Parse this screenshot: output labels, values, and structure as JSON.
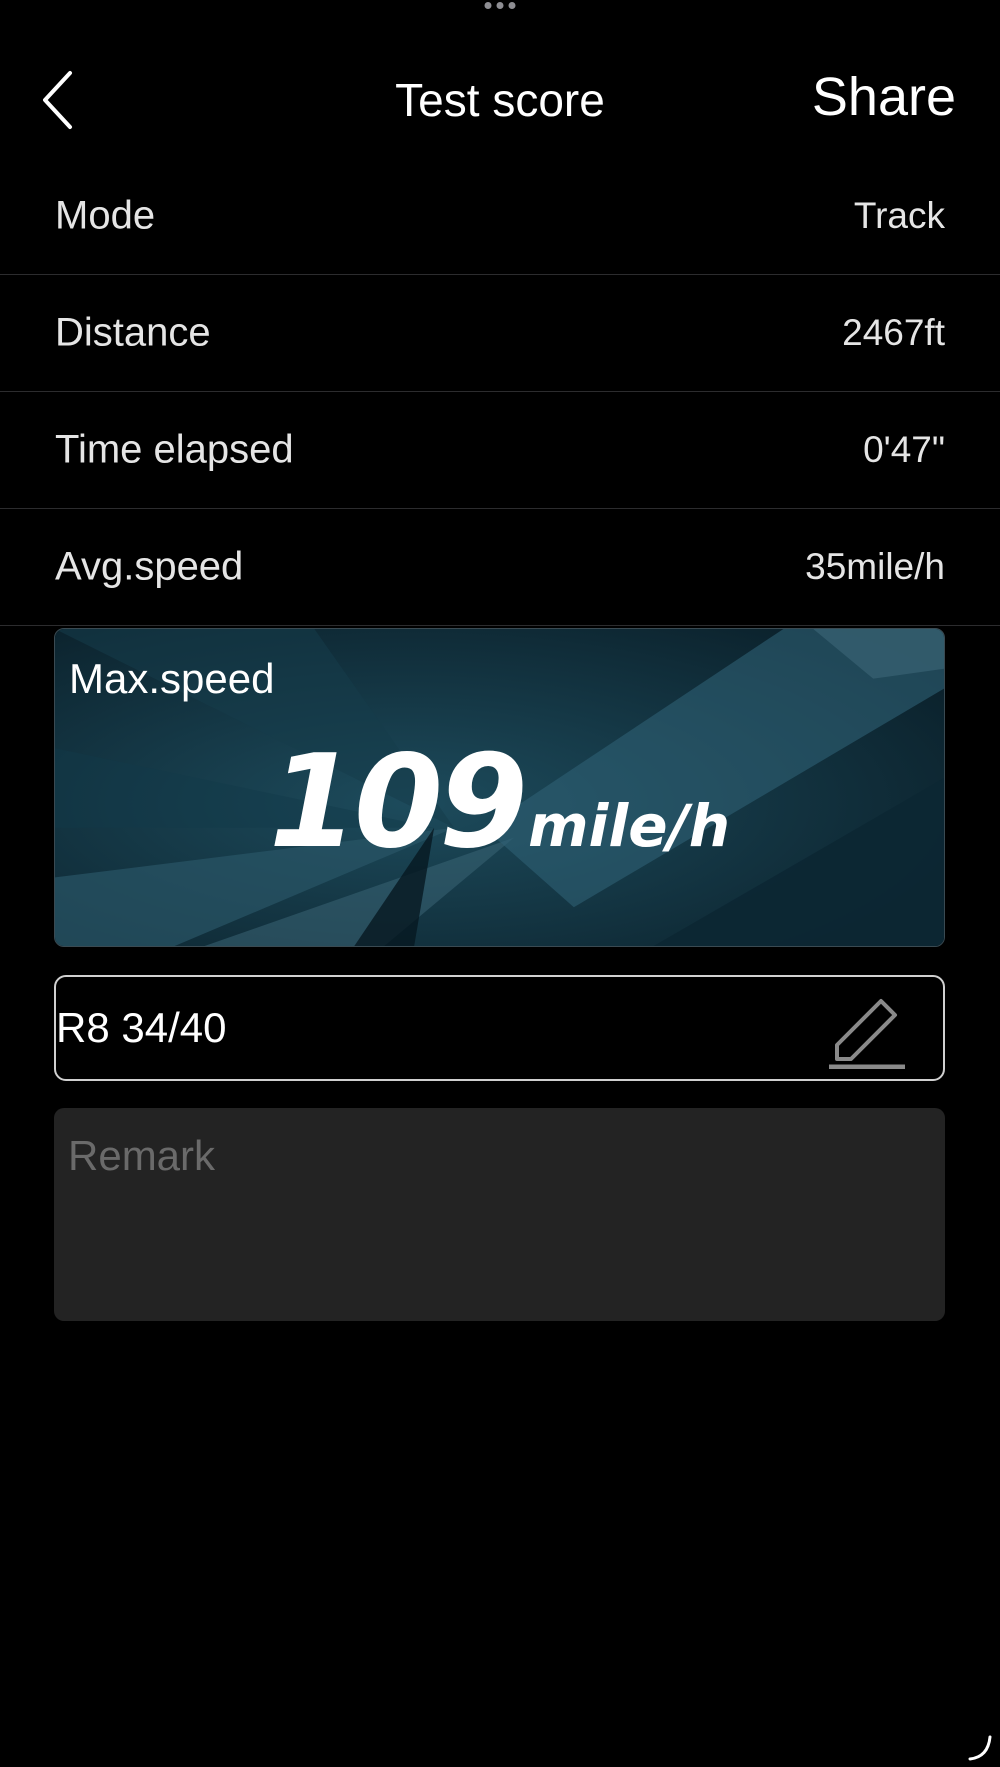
{
  "header": {
    "title": "Test score",
    "share_label": "Share"
  },
  "rows": [
    {
      "label": "Mode",
      "value": "Track"
    },
    {
      "label": "Distance",
      "value": "2467ft"
    },
    {
      "label": "Time elapsed",
      "value": "0'47\""
    },
    {
      "label": "Avg.speed",
      "value": "35mile/h"
    }
  ],
  "max_speed": {
    "label": "Max.speed",
    "value": "109",
    "unit": "mile/h"
  },
  "name_field": {
    "value": "R8 34/40"
  },
  "remark": {
    "placeholder": "Remark",
    "value": ""
  },
  "icons": {
    "back": "chevron-left-icon",
    "edit": "pencil-icon",
    "more": "more-dots-icon",
    "resize": "resize-handle-icon"
  },
  "colors": {
    "background": "#000000",
    "card_bg": "#0f2a36",
    "remark_bg": "#232323",
    "divider": "#2c2c2e",
    "text": "#ffffff",
    "placeholder": "#6a6a6a"
  }
}
